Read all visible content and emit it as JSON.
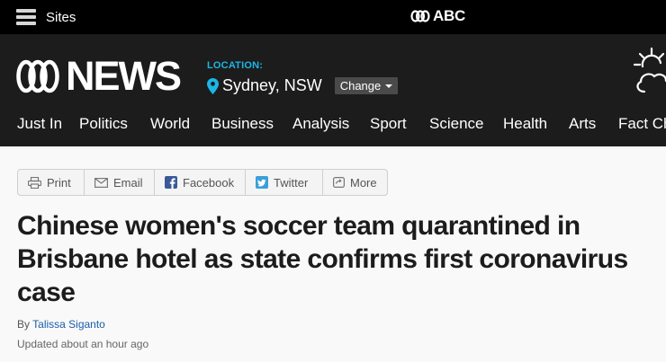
{
  "topbar": {
    "sites_label": "Sites",
    "brand_label": "ABC"
  },
  "masthead": {
    "logo_text": "NEWS",
    "location_label": "LOCATION:",
    "location_city": "Sydney, NSW",
    "change_label": "Change",
    "weather_icon": "partly-cloudy-icon"
  },
  "nav": {
    "items": [
      "Just In",
      "Politics",
      "World",
      "Business",
      "Analysis",
      "Sport",
      "Science",
      "Health",
      "Arts",
      "Fact Ch"
    ]
  },
  "share": {
    "print": "Print",
    "email": "Email",
    "facebook": "Facebook",
    "twitter": "Twitter",
    "more": "More"
  },
  "article": {
    "headline": "Chinese women's soccer team quarantined in Brisbane hotel as state confirms first coronavirus case",
    "byline_prefix": "By",
    "author": "Talissa Siganto",
    "updated": "Updated about an hour ago"
  },
  "colors": {
    "topbar": "#000000",
    "masthead": "#1c1c1c",
    "location_accent": "#1cb5e6",
    "author_link": "#1a5ea8",
    "facebook": "#3b5998",
    "twitter": "#3a9fd8"
  }
}
